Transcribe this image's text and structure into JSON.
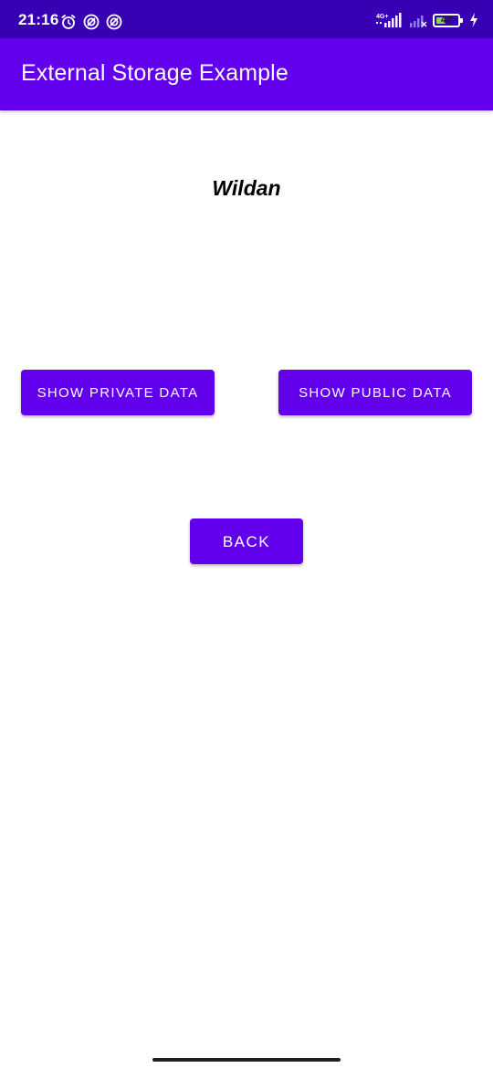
{
  "status_bar": {
    "time": "21:16",
    "network_label": "4G+",
    "battery_level": "47",
    "battery_fraction": 0.47,
    "left_icons": [
      "alarm-icon",
      "notification-icon",
      "notification-icon"
    ],
    "right_icons": [
      "signal-icon",
      "signal-weak-icon",
      "battery-icon",
      "charging-icon"
    ],
    "color": "#3700b3"
  },
  "app_bar": {
    "title": "External Storage Example",
    "color": "#6200ee"
  },
  "content": {
    "name_text": "Wildan"
  },
  "buttons": {
    "show_private_label": "SHOW PRIVATE DATA",
    "show_public_label": "SHOW PUBLIC DATA",
    "back_label": "BACK",
    "color": "#6200ee"
  }
}
